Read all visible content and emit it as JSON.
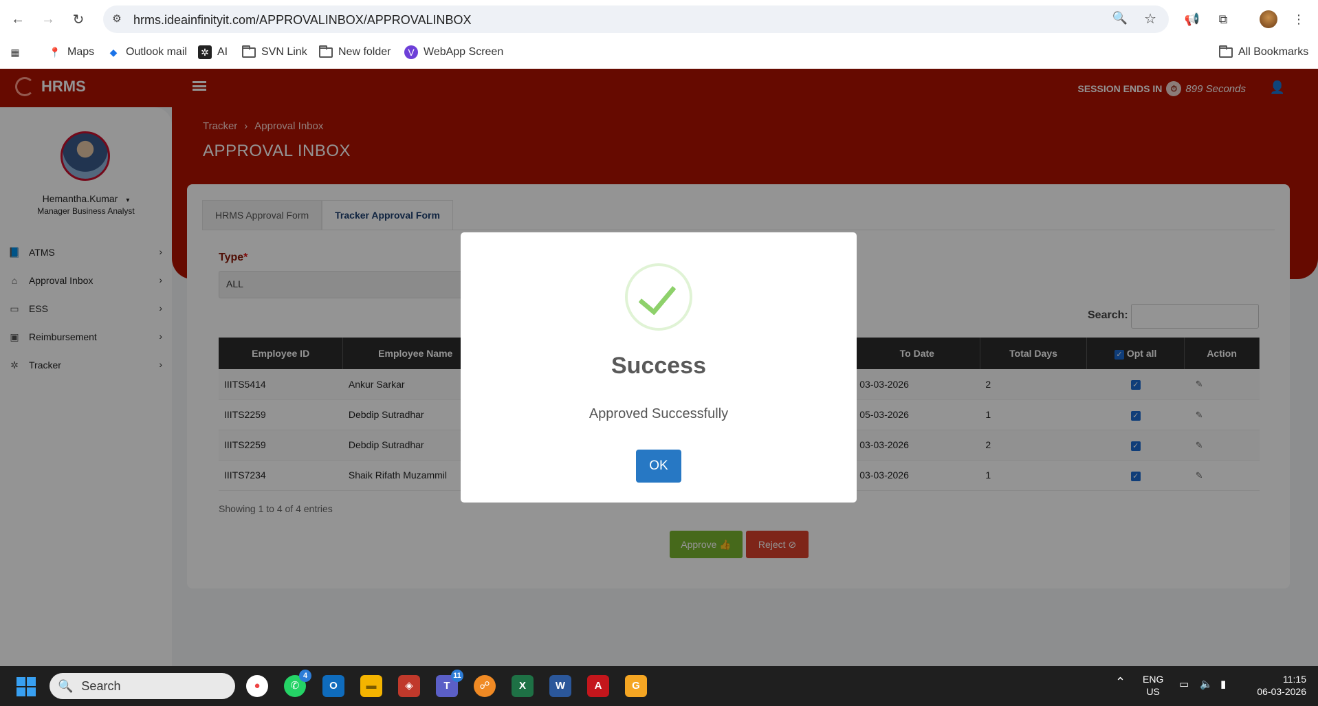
{
  "browser": {
    "url": "hrms.ideainfinityit.com/APPROVALINBOX/APPROVALINBOX",
    "bookmarks": [
      {
        "label": "Maps",
        "icon": "maps-icon"
      },
      {
        "label": "Outlook mail",
        "icon": "outlook-icon"
      },
      {
        "label": "AI",
        "icon": "ai-icon"
      },
      {
        "label": "SVN Link",
        "icon": "folder-icon"
      },
      {
        "label": "New folder",
        "icon": "folder-icon"
      },
      {
        "label": "WebApp Screen",
        "icon": "webapp-icon"
      }
    ],
    "all_bookmarks": "All Bookmarks"
  },
  "app": {
    "brand": "HRMS",
    "session_label": "SESSION ENDS IN",
    "session_seconds": "899 Seconds",
    "breadcrumb": [
      "Tracker",
      "Approval Inbox"
    ],
    "page_title": "APPROVAL INBOX"
  },
  "user": {
    "name": "Hemantha.Kumar",
    "role": "Manager Business Analyst"
  },
  "sidebar": {
    "items": [
      {
        "label": "ATMS",
        "icon": "book-icon"
      },
      {
        "label": "Approval Inbox",
        "icon": "home-icon"
      },
      {
        "label": "ESS",
        "icon": "monitor-icon"
      },
      {
        "label": "Reimbursement",
        "icon": "money-icon"
      },
      {
        "label": "Tracker",
        "icon": "gear-icon"
      }
    ]
  },
  "main": {
    "tabs": [
      {
        "label": "HRMS Approval Form",
        "active": false
      },
      {
        "label": "Tracker Approval Form",
        "active": true
      }
    ],
    "type_label": "Type",
    "type_value": "ALL",
    "search_label": "Search:",
    "table": {
      "headers": [
        "Employee ID",
        "Employee Name",
        "",
        "e",
        "To Date",
        "Total Days",
        "Opt all",
        "Action"
      ],
      "rows": [
        {
          "id": "IIITS5414",
          "name": "Ankur Sarkar",
          "to_date": "03-03-2026",
          "days": "2"
        },
        {
          "id": "IIITS2259",
          "name": "Debdip Sutradhar",
          "to_date": "05-03-2026",
          "days": "1"
        },
        {
          "id": "IIITS2259",
          "name": "Debdip Sutradhar",
          "to_date": "03-03-2026",
          "days": "2"
        },
        {
          "id": "IIITS7234",
          "name": "Shaik Rifath Muzammil",
          "to_date": "03-03-2026",
          "days": "1"
        }
      ]
    },
    "showing": "Showing 1 to 4 of 4 entries",
    "approve_label": "Approve",
    "reject_label": "Reject"
  },
  "modal": {
    "title": "Success",
    "message": "Approved Successfully",
    "ok_label": "OK"
  },
  "taskbar": {
    "search_placeholder": "Search",
    "whatsapp_badge": "4",
    "teams_badge": "11",
    "lang_line1": "ENG",
    "lang_line2": "US",
    "time": "11:15",
    "date": "06-03-2026"
  },
  "colors": {
    "brand_red": "#b01200",
    "approve_green": "#79b530",
    "reject_red": "#d9412c",
    "ok_blue": "#2778c4",
    "success_green": "#8ed16b"
  }
}
